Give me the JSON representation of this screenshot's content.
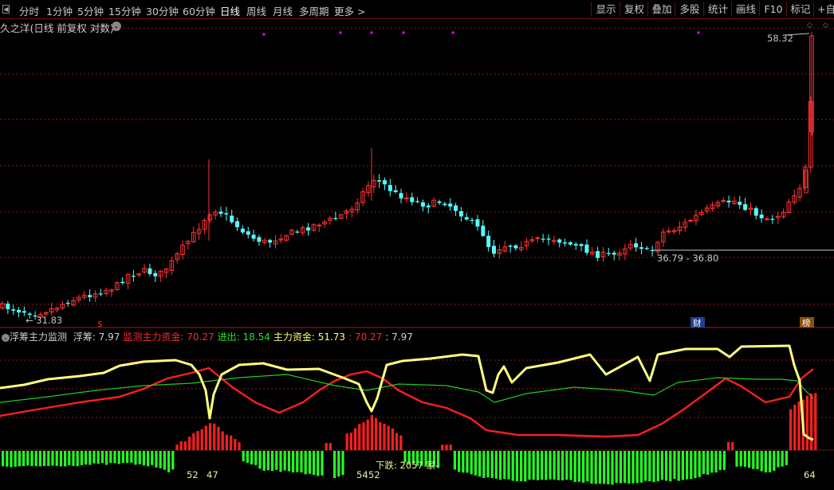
{
  "toolbar": {
    "periods": [
      "分时",
      "1分钟",
      "5分钟",
      "15分钟",
      "30分钟",
      "60分钟",
      "日线",
      "周线",
      "月线",
      "多周期",
      "更多 >"
    ],
    "active_period": "日线",
    "right_buttons": [
      "显示",
      "复权",
      "叠加",
      "多股",
      "统计",
      "画线",
      "F10",
      "标记",
      "+自选"
    ]
  },
  "chart": {
    "title": "久之洋(日线 前复权 对数)",
    "price_high_label": "58.32",
    "price_low_label": "31.83",
    "range_label": "36.79 - 36.80",
    "markers": [
      "$",
      "财",
      "榜"
    ]
  },
  "indicator": {
    "name": "浮筹主力监测",
    "items": [
      {
        "label": "浮筹:",
        "value": "7.97",
        "color": "#d0d0d0"
      },
      {
        "label": "监测主力资金:",
        "value": "70.27",
        "color": "#ff2828"
      },
      {
        "label": "进出:",
        "value": "18.54",
        "color": "#20e020"
      },
      {
        "label": "主力资金:",
        "value": "51.73",
        "color": "#ffff70"
      },
      {
        "label": ":",
        "value": "70.27",
        "color": "#ff2828"
      },
      {
        "label": ":",
        "value": "7.97",
        "color": "#d0d0d0"
      }
    ],
    "bottom_labels": [
      "52",
      "47",
      "54",
      "52",
      "64"
    ],
    "status_text": "下跌: 2057 家-"
  },
  "colors": {
    "up": "#ff3232",
    "down": "#54ffff",
    "grid": "#8b1a1a",
    "yellow_line": "#ffff80",
    "red_line": "#ff1e1e",
    "green_line": "#1ecc1e",
    "green_bar": "#22ff22",
    "red_bar": "#ff1e1e",
    "signal_dot": "#ff00ff"
  }
}
